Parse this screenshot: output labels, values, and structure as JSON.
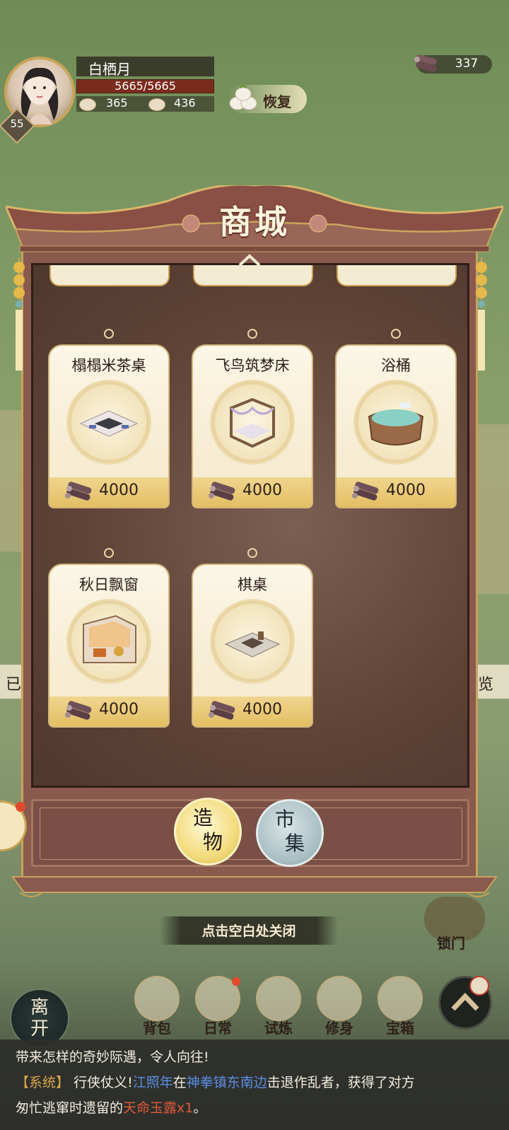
{
  "player": {
    "name": "白栖月",
    "level": "55",
    "hp": "5665/5665",
    "stat_a": "365",
    "stat_b": "436"
  },
  "recover_label": "恢复",
  "currency": "337",
  "shop": {
    "title": "商城",
    "items": [
      {
        "name": "榻榻米茶桌",
        "price": "4000",
        "icon": "tatami-table-icon"
      },
      {
        "name": "飞鸟筑梦床",
        "price": "4000",
        "icon": "canopy-bed-icon"
      },
      {
        "name": "浴桶",
        "price": "4000",
        "icon": "bathtub-icon"
      },
      {
        "name": "秋日飘窗",
        "price": "4000",
        "icon": "autumn-window-icon"
      },
      {
        "name": "棋桌",
        "price": "4000",
        "icon": "chess-table-icon"
      }
    ],
    "tabs": [
      {
        "label_1": "造",
        "label_2": "物",
        "active": true
      },
      {
        "label_1": "市",
        "label_2": "集",
        "active": false
      }
    ]
  },
  "close_hint": "点击空白处关闭",
  "side": {
    "left": "已",
    "right": "览",
    "lock_label": "锁门"
  },
  "nav": [
    {
      "label": "背包",
      "icon": "backpack-icon"
    },
    {
      "label": "日常",
      "icon": "daily-icon"
    },
    {
      "label": "试炼",
      "icon": "trial-icon"
    },
    {
      "label": "修身",
      "icon": "cultivation-icon"
    },
    {
      "label": "宝箱",
      "icon": "treasure-chest-icon"
    }
  ],
  "leave_label_1": "离",
  "leave_label_2": "开",
  "log": {
    "line1": "带来怎样的奇妙际遇，令人向往!",
    "tag": "【系统】",
    "p1": "行侠仗义!",
    "npc": "江照年",
    "p2": "在",
    "place": "神拳镇东南边",
    "p3": "击退作乱者，获得了对方",
    "p4": "匆忙逃窜时遗留的",
    "reward": "天命玉露x1",
    "p5": "。"
  },
  "colors": {
    "panel": "#8a5a4e",
    "gold": "#c8a25c",
    "card_footer": "#e3bf63",
    "system_tag": "#d9a64a",
    "highlight_blue": "#5b8fe6",
    "highlight_red": "#e05a3a"
  }
}
